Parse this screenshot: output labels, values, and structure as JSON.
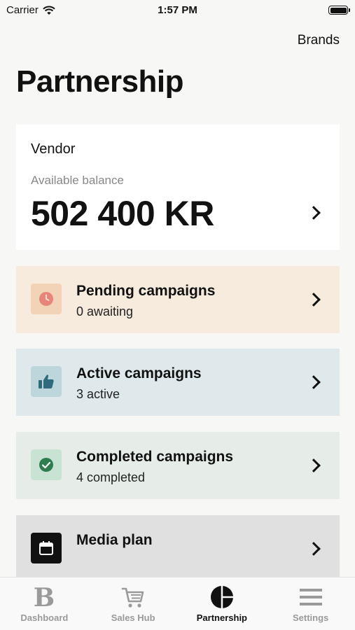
{
  "status_bar": {
    "carrier": "Carrier",
    "time": "1:57 PM"
  },
  "header": {
    "brands_link": "Brands",
    "title": "Partnership"
  },
  "balance_card": {
    "vendor": "Vendor",
    "available_label": "Available balance",
    "amount": "502 400 KR"
  },
  "rows": [
    {
      "title": "Pending campaigns",
      "subtitle": "0 awaiting",
      "icon": "clock-icon",
      "color": "#f6ebdc",
      "icon_color": "#e8857a"
    },
    {
      "title": "Active campaigns",
      "subtitle": "3 active",
      "icon": "thumbs-up-icon",
      "color": "#dfe9eb",
      "icon_color": "#2f6b7c"
    },
    {
      "title": "Completed campaigns",
      "subtitle": "4 completed",
      "icon": "check-circle-icon",
      "color": "#e6ede9",
      "icon_color": "#2e7d4f"
    },
    {
      "title": "Media plan",
      "subtitle": "",
      "icon": "calendar-icon",
      "color": "#e0e0e0",
      "icon_color": "#ffffff"
    }
  ],
  "tab_bar": {
    "tabs": [
      {
        "label": "Dashboard",
        "icon": "brand-b-icon",
        "selected": false
      },
      {
        "label": "Sales Hub",
        "icon": "cart-icon",
        "selected": false
      },
      {
        "label": "Partnership",
        "icon": "pie-chart-icon",
        "selected": true
      },
      {
        "label": "Settings",
        "icon": "menu-icon",
        "selected": false
      }
    ]
  }
}
